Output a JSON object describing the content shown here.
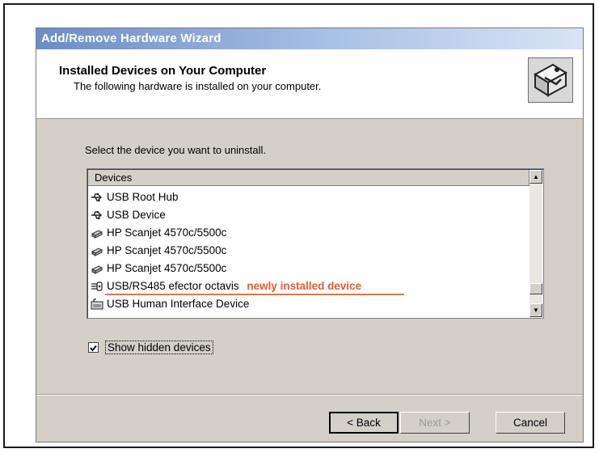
{
  "window": {
    "title": "Add/Remove Hardware Wizard"
  },
  "header": {
    "title": "Installed Devices on Your Computer",
    "subtitle": "The following hardware is installed on your computer."
  },
  "instruction": "Select the device you want to uninstall.",
  "device_list": {
    "column_header": "Devices",
    "items": [
      {
        "label": "USB Root Hub",
        "icon": "usb-icon"
      },
      {
        "label": "USB Device",
        "icon": "usb-icon"
      },
      {
        "label": "HP Scanjet 4570c/5500c",
        "icon": "scanner-icon"
      },
      {
        "label": "HP Scanjet 4570c/5500c",
        "icon": "scanner-icon"
      },
      {
        "label": "HP Scanjet 4570c/5500c",
        "icon": "scanner-icon"
      },
      {
        "label": "USB/RS485 efector octavis",
        "icon": "serial-port-icon",
        "annotation": "newly installed device"
      },
      {
        "label": "USB Human Interface Device",
        "icon": "hid-icon"
      }
    ]
  },
  "show_hidden": {
    "label": "Show hidden devices",
    "checked": true
  },
  "buttons": {
    "back": "< Back",
    "next": "Next >",
    "cancel": "Cancel"
  },
  "colors": {
    "annotation": "#e35a2e",
    "titlebar_start": "#6b8cc7",
    "dialog_bg": "#d4d0c8"
  }
}
